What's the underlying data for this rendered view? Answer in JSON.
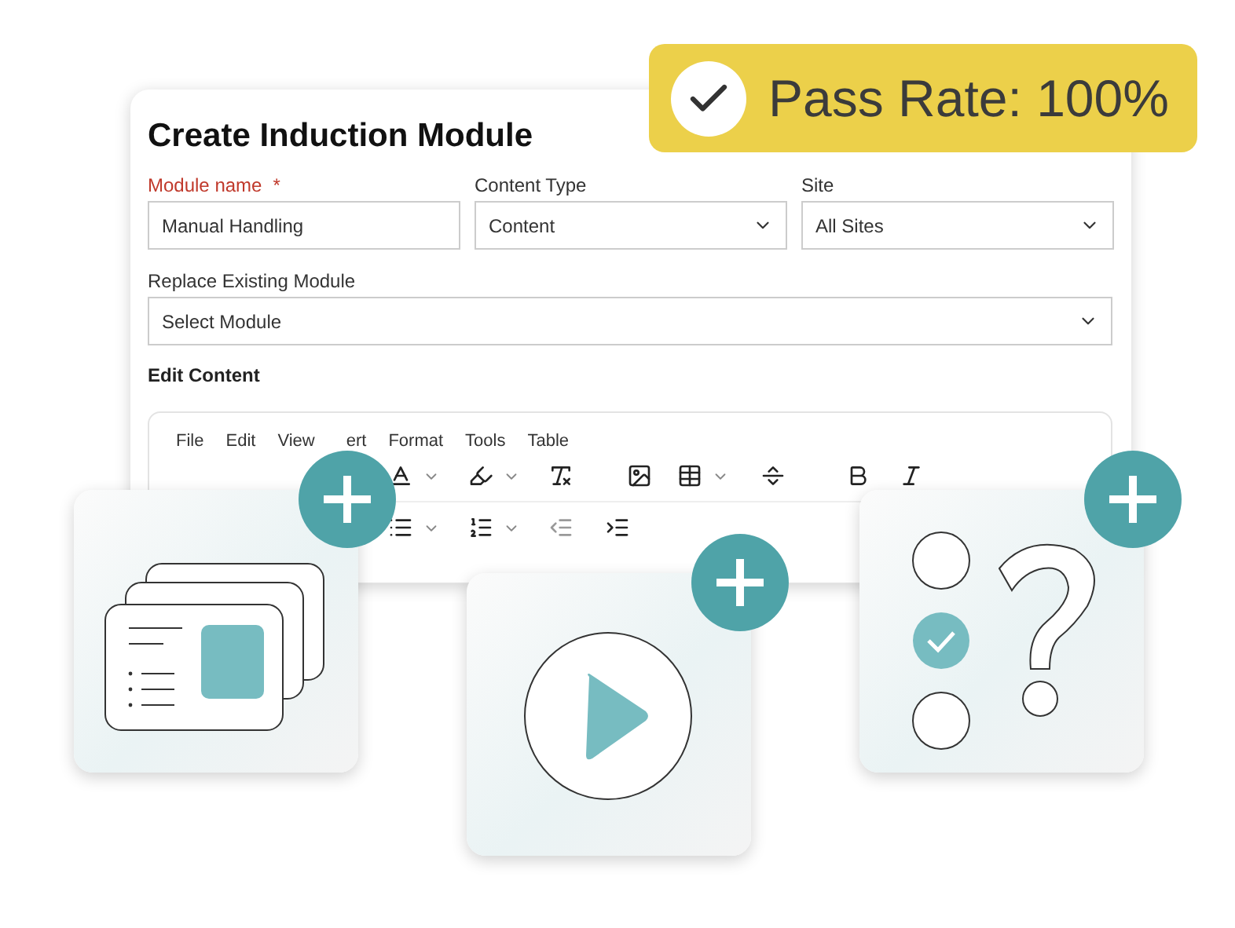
{
  "badge": {
    "text": "Pass Rate: 100%"
  },
  "form": {
    "title": "Create Induction Module",
    "fields": [
      {
        "label": "Module name",
        "required": true,
        "required_mark": "*",
        "kind": "text",
        "value": "Manual Handling"
      },
      {
        "label": "Content Type",
        "required": false,
        "kind": "select",
        "value": "Content"
      },
      {
        "label": "Site",
        "required": false,
        "kind": "select",
        "value": "All Sites"
      }
    ],
    "replace": {
      "label": "Replace Existing Module",
      "value": "Select Module"
    },
    "section": "Edit Content",
    "menu": [
      "File",
      "Edit",
      "View",
      "ert",
      "Format",
      "Tools",
      "Table"
    ]
  },
  "cards": [
    {
      "kind": "slides"
    },
    {
      "kind": "video"
    },
    {
      "kind": "quiz",
      "options": [
        {
          "checked": false
        },
        {
          "checked": true
        },
        {
          "checked": false
        }
      ]
    }
  ]
}
